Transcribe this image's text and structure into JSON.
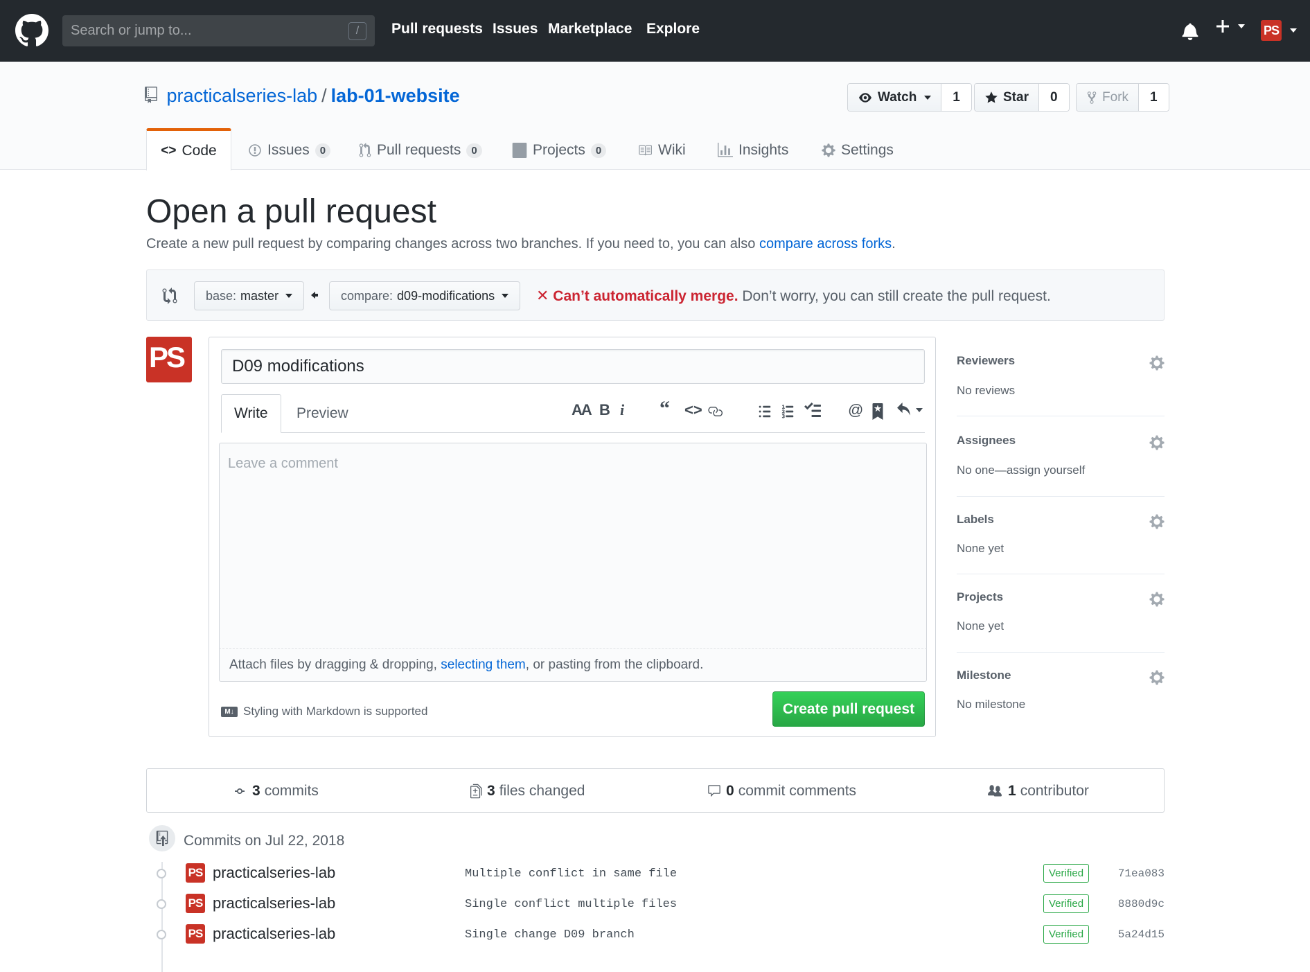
{
  "topnav": {
    "search_placeholder": "Search or jump to...",
    "search_shortcut": "/",
    "links": [
      "Pull requests",
      "Issues",
      "Marketplace",
      "Explore"
    ]
  },
  "repo": {
    "owner": "practicalseries-lab",
    "separator": "/",
    "name": "lab-01-website",
    "watch_label": "Watch",
    "watch_count": "1",
    "star_label": "Star",
    "star_count": "0",
    "fork_label": "Fork",
    "fork_count": "1"
  },
  "tabs": {
    "code": "Code",
    "issues": "Issues",
    "issues_count": "0",
    "pulls": "Pull requests",
    "pulls_count": "0",
    "projects": "Projects",
    "projects_count": "0",
    "wiki": "Wiki",
    "insights": "Insights",
    "settings": "Settings"
  },
  "page": {
    "title": "Open a pull request",
    "lead_text": "Create a new pull request by comparing changes across two branches. If you need to, you can also",
    "lead_link": "compare across forks",
    "lead_end": "."
  },
  "range": {
    "base_prefix": "base:",
    "base_value": "master",
    "compare_prefix": "compare:",
    "compare_value": "d09-modifications",
    "merge_error": "Can’t automatically merge.",
    "merge_note": "Don’t worry, you can still create the pull request."
  },
  "form": {
    "title_value": "D09 modifications",
    "tab_write": "Write",
    "tab_preview": "Preview",
    "comment_placeholder": "Leave a comment",
    "attach_text": "Attach files by dragging & dropping,",
    "attach_link": "selecting them",
    "attach_end": ", or pasting from the clipboard.",
    "markdown_note": "Styling with Markdown is supported",
    "markdown_badge": "M↓",
    "submit": "Create pull request",
    "toolbar": {
      "header": "AA",
      "bold": "B",
      "italic": "i",
      "mention": "@"
    }
  },
  "sidebar": [
    {
      "title": "Reviewers",
      "value": "No reviews"
    },
    {
      "title": "Assignees",
      "value": "No one—assign yourself"
    },
    {
      "title": "Labels",
      "value": "None yet"
    },
    {
      "title": "Projects",
      "value": "None yet"
    },
    {
      "title": "Milestone",
      "value": "No milestone"
    }
  ],
  "stats": {
    "commits_n": "3",
    "commits_label": "commits",
    "files_n": "3",
    "files_label": "files changed",
    "comments_n": "0",
    "comments_label": "commit comments",
    "contrib_n": "1",
    "contrib_label": "contributor"
  },
  "commits_header": "Commits on Jul 22, 2018",
  "commits": [
    {
      "author": "practicalseries-lab",
      "message": "Multiple conflict in same file",
      "badge": "Verified",
      "sha": "71ea083"
    },
    {
      "author": "practicalseries-lab",
      "message": "Single conflict multiple files",
      "badge": "Verified",
      "sha": "8880d9c"
    },
    {
      "author": "practicalseries-lab",
      "message": "Single change D09 branch",
      "badge": "Verified",
      "sha": "5a24d15"
    }
  ],
  "avatar_initials": "PS",
  "colors": {
    "header_bg": "#24292e",
    "link": "#0366d6",
    "accent_tab": "#e36209",
    "create_btn": "#28a745",
    "error": "#cb2431",
    "avatar": "#c93226"
  }
}
